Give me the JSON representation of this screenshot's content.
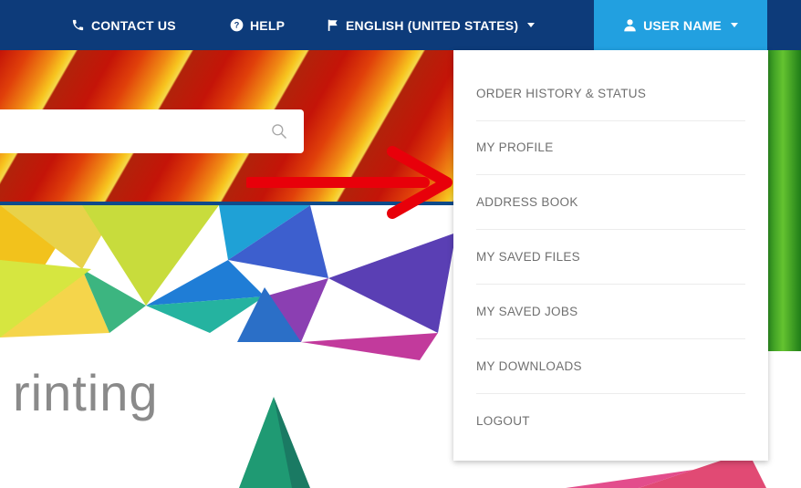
{
  "topbar": {
    "contact_label": "CONTACT US",
    "help_label": "HELP",
    "language_label": "ENGLISH (UNITED STATES)",
    "user_label": "USER NAME",
    "bg_color": "#0d3b7a",
    "user_bg_color": "#22a0e0"
  },
  "icons": {
    "contact": "phone-icon",
    "help": "question-circle-icon",
    "language": "flag-icon",
    "user": "user-icon",
    "search": "search-icon"
  },
  "search": {
    "placeholder": ""
  },
  "hero_text": "rinting",
  "dropdown": {
    "items": [
      {
        "label": "ORDER HISTORY & STATUS"
      },
      {
        "label": "MY PROFILE"
      },
      {
        "label": "ADDRESS BOOK"
      },
      {
        "label": "MY SAVED FILES"
      },
      {
        "label": "MY SAVED JOBS"
      },
      {
        "label": "MY DOWNLOADS"
      },
      {
        "label": "LOGOUT"
      }
    ]
  },
  "annotation": {
    "arrow_color": "#e8000a"
  }
}
